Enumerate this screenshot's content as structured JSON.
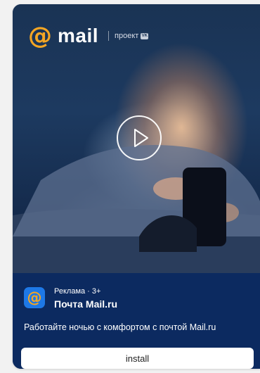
{
  "ad": {
    "logo": {
      "at_symbol": "@",
      "wordmark": "mail",
      "project_label": "проект",
      "vk_badge": "VK"
    },
    "media": {
      "play_icon": "play-icon"
    },
    "app_icon": {
      "glyph": "@",
      "icon_name": "mail-app-icon"
    },
    "meta": "Реклама · 3+",
    "app_name": "Почта Mail.ru",
    "description": "Работайте ночью с комфортом с почтой Mail.ru",
    "install_label": "install"
  },
  "colors": {
    "accent": "#f5a623",
    "info_background": "#0c2a60",
    "app_icon_background": "#1e78e6",
    "button_background": "#ffffff"
  }
}
